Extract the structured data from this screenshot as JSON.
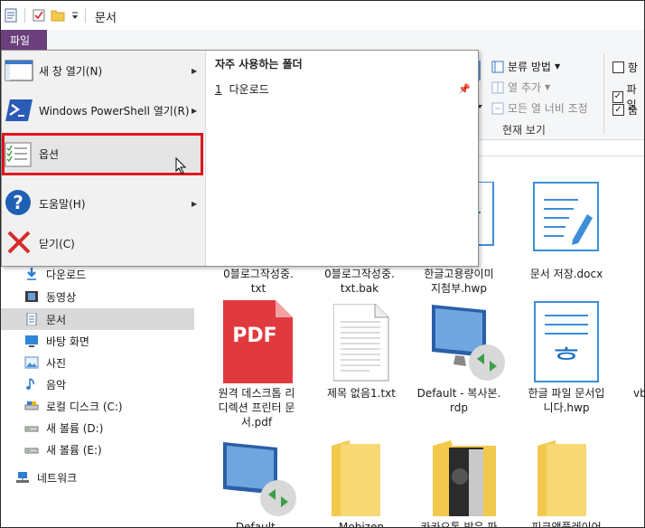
{
  "window": {
    "title": "문서"
  },
  "ribbon": {
    "file_tab": "파일",
    "sort_by": "분류 방법",
    "add_column": "열 추가",
    "size_all_columns": "모든 열 너비 조정",
    "group_label": "현재 보기",
    "check1": "항",
    "check2": "파일",
    "check3": "숨"
  },
  "file_menu": {
    "items": [
      {
        "label": "새 창 열기(N)",
        "has_submenu": true
      },
      {
        "label": "Windows PowerShell 열기(R)",
        "has_submenu": true
      },
      {
        "label": "옵션",
        "has_submenu": false
      },
      {
        "label": "도움말(H)",
        "has_submenu": true
      },
      {
        "label": "닫기(C)",
        "has_submenu": false
      }
    ],
    "frequent_title": "자주 사용하는 폴더",
    "frequent": [
      {
        "index": "1",
        "label": "다운로드"
      }
    ]
  },
  "nav": {
    "items": [
      {
        "label": "다운로드",
        "icon": "download-icon"
      },
      {
        "label": "동영상",
        "icon": "video-icon"
      },
      {
        "label": "문서",
        "icon": "document-icon",
        "selected": true
      },
      {
        "label": "바탕 화면",
        "icon": "desktop-icon"
      },
      {
        "label": "사진",
        "icon": "picture-icon"
      },
      {
        "label": "음악",
        "icon": "music-icon"
      },
      {
        "label": "로컬 디스크 (C:)",
        "icon": "drive-icon"
      },
      {
        "label": "새 볼륨 (D:)",
        "icon": "drive-icon"
      },
      {
        "label": "새 볼륨 (E:)",
        "icon": "drive-icon"
      },
      {
        "label": "네트워크",
        "icon": "network-icon"
      }
    ]
  },
  "files": {
    "row1": [
      {
        "name": "0블로그작성중.\ntxt"
      },
      {
        "name": "0블로그작성중.\ntxt.bak"
      },
      {
        "name": "한글고용량이미\n지첨부.hwp"
      },
      {
        "name": "문서 저장.docx"
      }
    ],
    "row2": [
      {
        "name": "원격 데스크톱 리\n디렉션 프린터 문\n서.pdf",
        "badge": "PDF"
      },
      {
        "name": "제목 없음1.txt"
      },
      {
        "name": "Default - 복사본.\nrdp"
      },
      {
        "name": "한글 파일 문서입\n니다.hwp"
      },
      {
        "name": "vb"
      }
    ],
    "row3": [
      {
        "name": "Default-DESKTO"
      },
      {
        "name": "Mobizen"
      },
      {
        "name": "카카오톡 받은 파"
      },
      {
        "name": "피크앤플레이어"
      },
      {
        "name": ""
      }
    ]
  },
  "colors": {
    "file_tab": "#6a3f7c",
    "highlight": "#e0151d",
    "selected_nav": "#d9d9d9"
  }
}
